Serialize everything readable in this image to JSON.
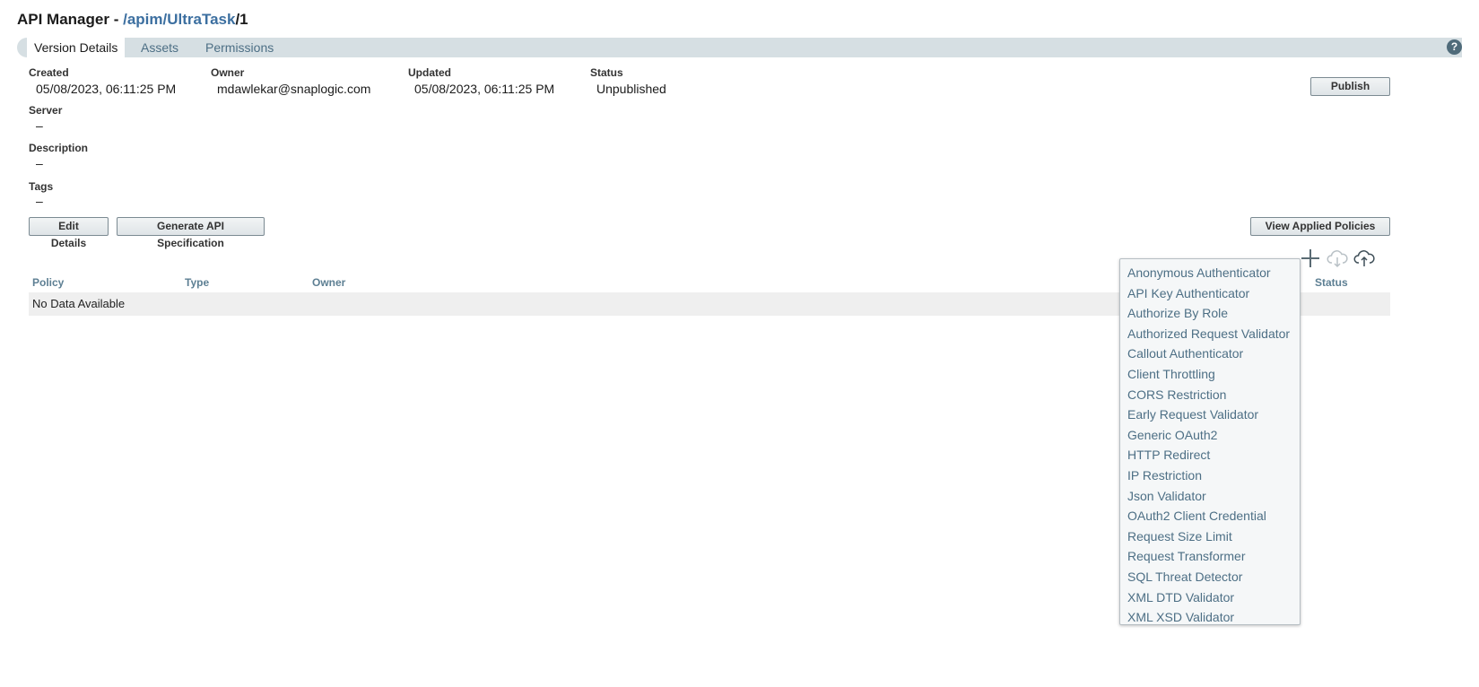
{
  "header": {
    "app": "API Manager",
    "separator": " - ",
    "path_part1": "/apim",
    "path_part2": "/UltraTask",
    "version": "/1"
  },
  "tabs": [
    "Version Details",
    "Assets",
    "Permissions"
  ],
  "help": "?",
  "details": {
    "created_label": "Created",
    "created_value": "05/08/2023, 06:11:25 PM",
    "owner_label": "Owner",
    "owner_value": "mdawlekar@snaplogic.com",
    "updated_label": "Updated",
    "updated_value": "05/08/2023, 06:11:25 PM",
    "status_label": "Status",
    "status_value": "Unpublished",
    "server_label": "Server",
    "server_value": "–",
    "description_label": "Description",
    "description_value": "–",
    "tags_label": "Tags",
    "tags_value": "–"
  },
  "buttons": {
    "publish": "Publish",
    "edit_details": "Edit Details",
    "generate_spec": "Generate API Specification",
    "view_policies": "View Applied Policies"
  },
  "table": {
    "columns": [
      "Policy",
      "Type",
      "Owner",
      "Status"
    ],
    "empty_text": "No Data Available"
  },
  "toolbar_icons": [
    "plus-icon",
    "cloud-download-icon",
    "cloud-upload-icon"
  ],
  "policy_menu": [
    "Anonymous Authenticator",
    "API Key Authenticator",
    "Authorize By Role",
    "Authorized Request Validator",
    "Callout Authenticator",
    "Client Throttling",
    "CORS Restriction",
    "Early Request Validator",
    "Generic OAuth2",
    "HTTP Redirect",
    "IP Restriction",
    "Json Validator",
    "OAuth2 Client Credential",
    "Request Size Limit",
    "Request Transformer",
    "SQL Threat Detector",
    "XML DTD Validator",
    "XML XSD Validator"
  ],
  "colors": {
    "link": "#3c6fa0",
    "tab_bar": "#d6dfe3",
    "menu_text": "#4d6f85",
    "header_text": "#5d7f93"
  }
}
